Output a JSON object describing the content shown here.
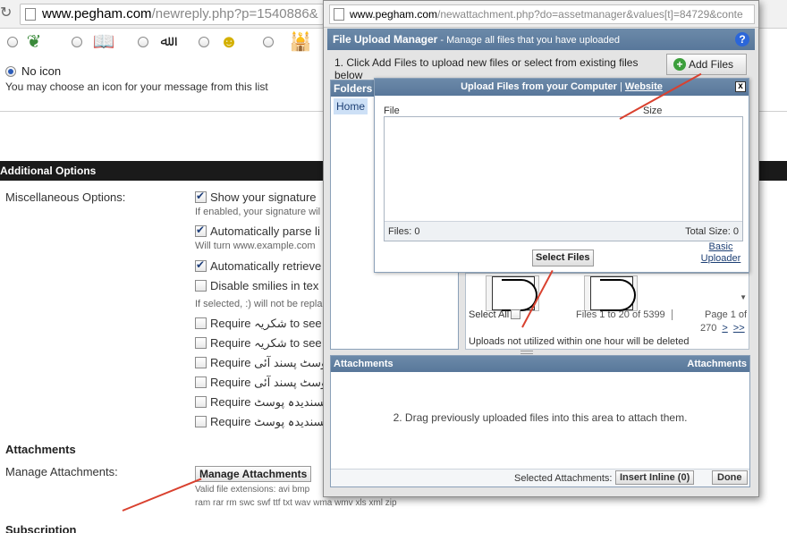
{
  "browser": {
    "url_host": "www.pegham.com",
    "url_path": "/newreply.php?p=1540886&"
  },
  "post_icons": {
    "icons": [
      "islamic-calligraphy-icon",
      "quran-book-icon",
      "allah-calligraphy-icon",
      "smiley-pakistan-flag-icon",
      "mosque-icon"
    ],
    "no_icon_label": "No icon",
    "help_text": "You may choose an icon for your message from this list"
  },
  "additional_options": {
    "title": "Additional Options",
    "misc_label": "Miscellaneous Options:",
    "options": [
      {
        "label": "Show your signature",
        "checked": true
      },
      {
        "label": "Automatically parse li",
        "checked": true
      },
      {
        "label": "Automatically retrieve",
        "checked": true
      },
      {
        "label": "Disable smilies in tex",
        "checked": false
      },
      {
        "label": "Require شکریہ to see c",
        "checked": false
      },
      {
        "label": "Require شکریہ to see a",
        "checked": false
      },
      {
        "label": "Require پوسٹ پسند آئی to",
        "checked": false
      },
      {
        "label": "Require پوسٹ پسند آئی to",
        "checked": false
      },
      {
        "label": "Require ناپسندیدہ پوسٹ to",
        "checked": false
      },
      {
        "label": "Require ناپسندیدہ پوسٹ to",
        "checked": false
      }
    ],
    "help": {
      "signature": "If enabled, your signature wil",
      "parse": "Will turn www.example.com",
      "smilies": "If selected, :) will not be repla"
    }
  },
  "attachments_section": {
    "heading": "Attachments",
    "manage_label": "Manage Attachments:",
    "manage_button": "Manage Attachments",
    "valid_ext_line1": "Valid file extensions: avi bmp",
    "valid_ext_line2": "ram rar rm swc swf ttf txt wav wma wmv xls xml zip"
  },
  "subscription_heading": "Subscription",
  "popup": {
    "url_host": "www.pegham.com",
    "url_path": "/newattachment.php?do=assetmanager&values[t]=84729&conte",
    "header_title": "File Upload Manager",
    "header_sep": " - ",
    "header_subtitle": "Manage all files that you have uploaded",
    "step1": "1. Click Add Files to upload new files or select from existing files below",
    "add_files": "Add Files",
    "folders_title": "Folders",
    "home": "Home",
    "upload": {
      "title": "Upload Files from your Computer",
      "divider": " | ",
      "website": "Website",
      "col_file": "File",
      "col_size": "Size",
      "files_count": "Files: 0",
      "total_size": "Total Size: 0",
      "select_files": "Select Files",
      "basic_uploader": "Basic Uploader"
    },
    "select_all": "Select All",
    "files_range": "Files 1 to 20 of 5399",
    "page_info": "Page 1 of",
    "page_total": "270",
    "next": ">",
    "last": ">>",
    "uploads_note": "Uploads not utilized within one hour will be deleted",
    "attachments_title": "Attachments",
    "attachments_right": "Attachments",
    "drag_msg": "2. Drag previously uploaded files into this area to attach them.",
    "selected_attachments": "Selected Attachments:",
    "insert_inline": "Insert Inline (0)",
    "done": "Done"
  }
}
